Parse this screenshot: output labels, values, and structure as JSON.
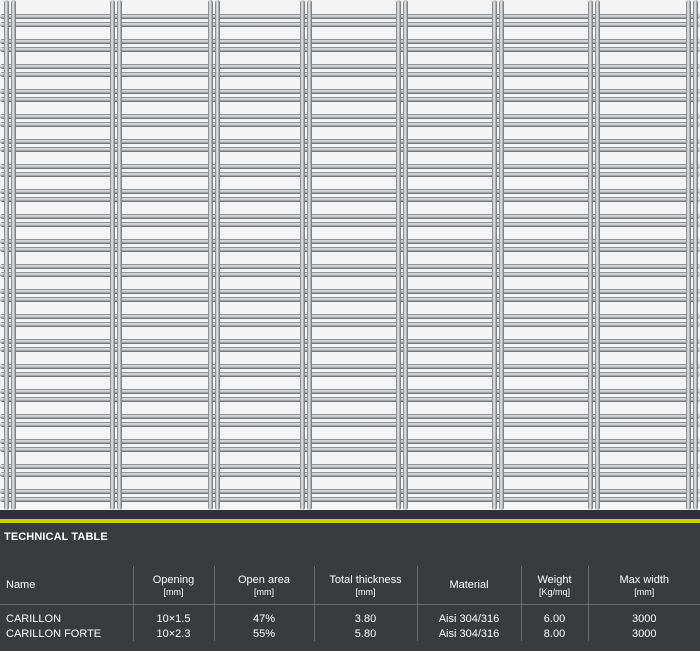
{
  "image": {
    "subject": "stainless-steel-woven-wire-mesh",
    "colors": {
      "background": "#f4f4f4",
      "wire": "#8f9296",
      "wire_highlight": "#e6e7e8"
    }
  },
  "colors": {
    "panel": "#3a3b3d",
    "accent": "#c8d400",
    "text": "#ffffff",
    "rule": "#6a6b6d"
  },
  "section": {
    "title": "TECHNICAL TABLE"
  },
  "table": {
    "headers": [
      {
        "label": "Name",
        "unit": ""
      },
      {
        "label": "Opening",
        "unit": "[mm]"
      },
      {
        "label": "Open area",
        "unit": "[mm]"
      },
      {
        "label": "Total thickness",
        "unit": "[mm]"
      },
      {
        "label": "Material",
        "unit": ""
      },
      {
        "label": "Weight",
        "unit": "[Kg/mq]"
      },
      {
        "label": "Max width",
        "unit": "[mm]"
      }
    ],
    "rows": [
      [
        "CARILLON",
        "10×1.5",
        "47%",
        "3.80",
        "Aisi 304/316",
        "6.00",
        "3000"
      ],
      [
        "CARILLON FORTE",
        "10×2.3",
        "55%",
        "5.80",
        "Aisi 304/316",
        "8.00",
        "3000"
      ]
    ]
  }
}
